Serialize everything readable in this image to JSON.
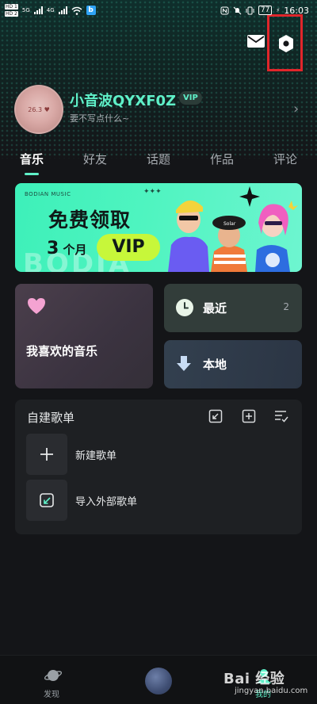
{
  "status_bar": {
    "sim1": "HD 1",
    "sim2": "HD 2",
    "net1": "5G",
    "net2": "4G",
    "battery": "77",
    "time": "16:03"
  },
  "header": {
    "mail_icon": "mail-icon",
    "settings_icon": "hexagon-settings-icon",
    "highlight_color": "#e0262b"
  },
  "profile": {
    "avatar_text": "26.3 ♥",
    "username": "小音波QYXF0Z",
    "badge": "VIP",
    "bio": "要不写点什么~",
    "chevron": "›"
  },
  "tabs": [
    {
      "label": "音乐",
      "active": true
    },
    {
      "label": "好友",
      "active": false
    },
    {
      "label": "话题",
      "active": false
    },
    {
      "label": "作品",
      "active": false
    },
    {
      "label": "评论",
      "active": false
    }
  ],
  "banner": {
    "brand": "BODIAN MUSIC",
    "dots": "✦✦✦",
    "title": "免费领取",
    "months_num": "3",
    "months_unit": "个月",
    "vip": "VIP",
    "bg_text": "BODIA"
  },
  "cards": {
    "favorites": {
      "label": "我喜欢的音乐",
      "icon": "heart-icon"
    },
    "recent": {
      "label": "最近",
      "count": "2",
      "icon": "clock-icon"
    },
    "local": {
      "label": "本地",
      "icon": "download-icon"
    }
  },
  "playlists": {
    "title": "自建歌单",
    "tools": [
      "import-icon",
      "add-icon",
      "manage-list-icon"
    ],
    "items": [
      {
        "label": "新建歌单",
        "icon": "plus-icon"
      },
      {
        "label": "导入外部歌单",
        "icon": "import-icon"
      }
    ]
  },
  "bottom_nav": {
    "discover": "发现",
    "mine": "我的"
  },
  "watermark": {
    "main": "Bai 经验",
    "sub": "jingyan.baidu.com"
  },
  "colors": {
    "accent": "#5ff0c8",
    "background": "#141518",
    "banner_green": "#3df0b9",
    "vip_lime": "#c7f73a"
  }
}
